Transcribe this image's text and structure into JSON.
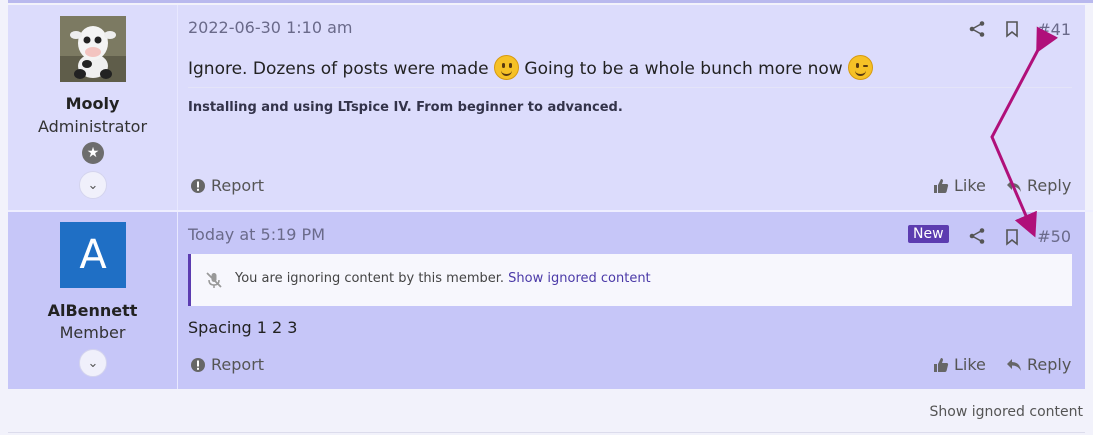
{
  "posts": [
    {
      "username": "Mooly",
      "user_title": "Administrator",
      "date": "2022-06-30 1:10 am",
      "post_number": "#41",
      "message_part1": "Ignore. Dozens of posts were made ",
      "message_part2": " Going to be a whole bunch more now ",
      "signature": "Installing and using LTspice IV. From beginner to advanced.",
      "report_label": "Report",
      "like_label": "Like",
      "reply_label": "Reply"
    },
    {
      "username": "AlBennett",
      "avatar_letter": "A",
      "user_title": "Member",
      "date": "Today at 5:19 PM",
      "new_badge": "New",
      "post_number": "#50",
      "ignored_notice": "You are ignoring content by this member.",
      "ignored_link": "Show ignored content",
      "message": "Spacing 1 2 3",
      "report_label": "Report",
      "like_label": "Like",
      "reply_label": "Reply"
    }
  ],
  "footer": {
    "show_ignored": "Show ignored content"
  },
  "colors": {
    "annotation_arrow": "#b0107a",
    "new_badge": "#5c3cb0",
    "post_bg": "#dcdcfc",
    "post_new_bg": "#c6c6f8"
  },
  "icons": [
    "share-icon",
    "bookmark-icon",
    "thumbs-up-icon",
    "reply-icon",
    "report-icon",
    "star-icon",
    "chevron-down-icon",
    "mute-icon",
    "smile-emoji",
    "wink-emoji"
  ]
}
